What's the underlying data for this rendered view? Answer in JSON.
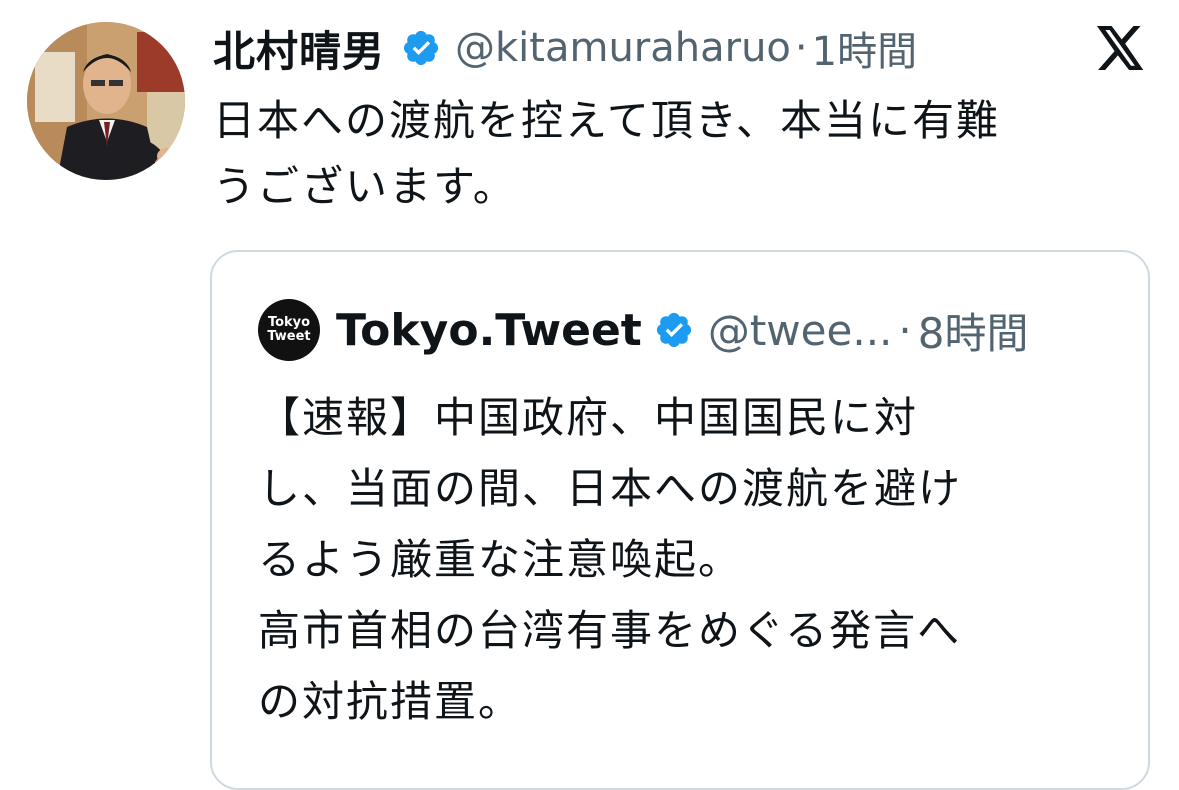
{
  "tweet": {
    "author": {
      "display_name": "北村晴男",
      "handle": "@kitamuraharuo",
      "verified": true,
      "avatar_icon": "profile-photo"
    },
    "separator": "·",
    "time": "1時間",
    "text": "日本への渡航を控えて頂き、本当に有難\nうございます。",
    "platform_icon": "x-logo-icon"
  },
  "quoted_tweet": {
    "author": {
      "display_name": "Tokyo.Tweet",
      "handle": "@twee...",
      "verified": true,
      "avatar_text_line1": "Tokyo",
      "avatar_text_line2": "Tweet"
    },
    "separator": "·",
    "time": "8時間",
    "text": "【速報】中国政府、中国国民に対\nし、当面の間、日本への渡航を避け\nるよう厳重な注意喚起。\n高市首相の台湾有事をめぐる発言へ\nの対抗措置。"
  },
  "colors": {
    "primary_text": "#0f1419",
    "secondary_text": "#536471",
    "verified_blue": "#1d9bf0",
    "card_border": "#cfd9de"
  }
}
